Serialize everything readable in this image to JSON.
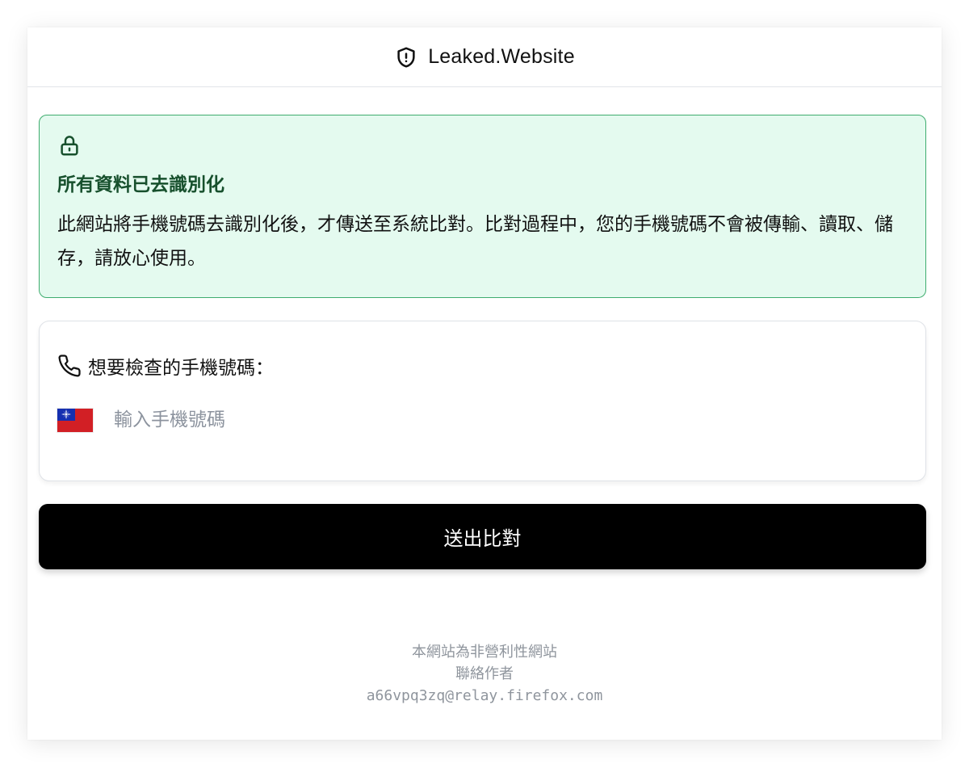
{
  "header": {
    "title": "Leaked.Website",
    "icon": "shield-alert-icon"
  },
  "notice": {
    "icon": "lock-icon",
    "title": "所有資料已去識別化",
    "body": "此網站將手機號碼去識別化後，才傳送至系統比對。比對過程中，您的手機號碼不會被傳輸、讀取、儲存，請放心使用。",
    "colors": {
      "background": "#e4faef",
      "border": "#3eac6e",
      "title": "#17502d"
    }
  },
  "form": {
    "icon": "phone-icon",
    "label": "想要檢查的手機號碼：",
    "country_flag": "taiwan-flag-icon",
    "phone_placeholder": "輸入手機號碼",
    "phone_value": ""
  },
  "submit": {
    "label": "送出比對"
  },
  "footer": {
    "line1": "本網站為非營利性網站",
    "line2": "聯絡作者",
    "email": "a66vpq3zq@relay.firefox.com"
  }
}
